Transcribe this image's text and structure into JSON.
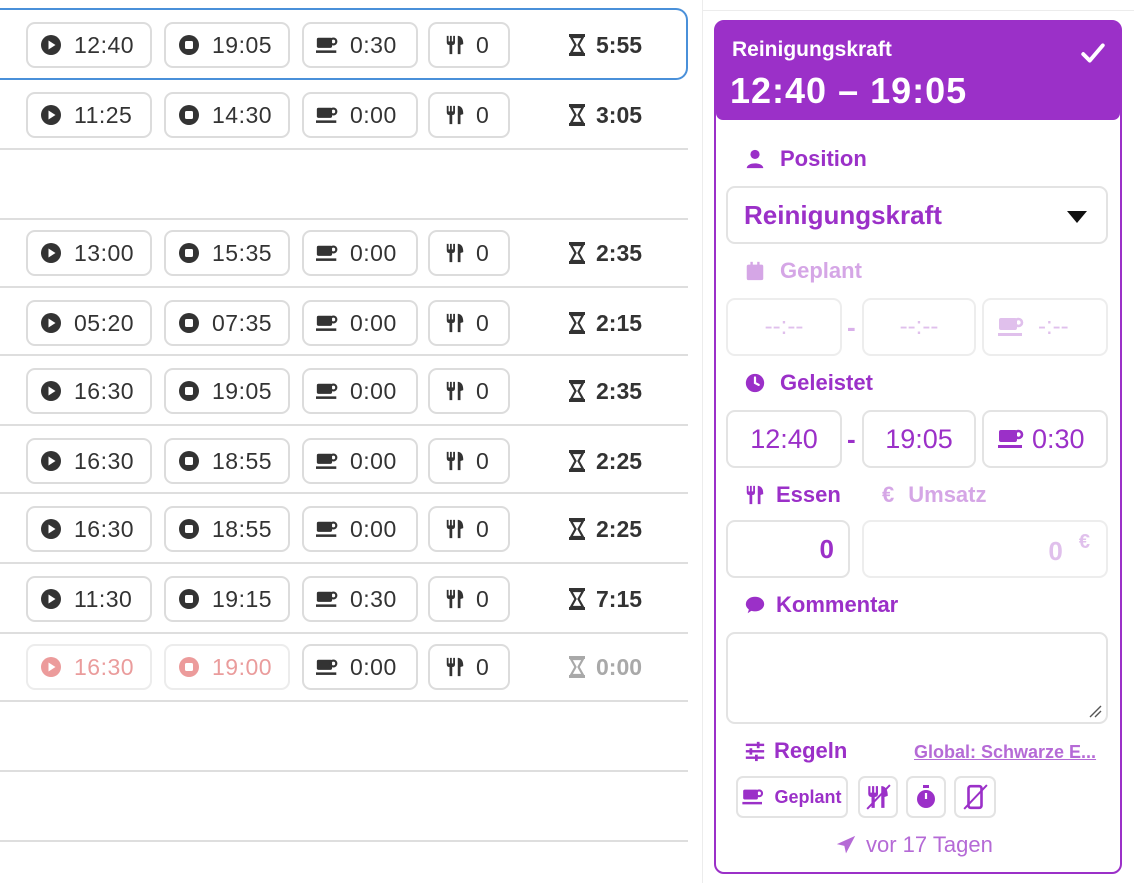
{
  "rows": [
    {
      "start": "12:40",
      "end": "19:05",
      "pause": "0:30",
      "meals": "0",
      "total": "5:55",
      "selected": true,
      "faded": false
    },
    {
      "start": "11:25",
      "end": "14:30",
      "pause": "0:00",
      "meals": "0",
      "total": "3:05",
      "selected": false,
      "faded": false
    },
    {
      "start": "13:00",
      "end": "15:35",
      "pause": "0:00",
      "meals": "0",
      "total": "2:35",
      "selected": false,
      "faded": false
    },
    {
      "start": "05:20",
      "end": "07:35",
      "pause": "0:00",
      "meals": "0",
      "total": "2:15",
      "selected": false,
      "faded": false
    },
    {
      "start": "16:30",
      "end": "19:05",
      "pause": "0:00",
      "meals": "0",
      "total": "2:35",
      "selected": false,
      "faded": false
    },
    {
      "start": "16:30",
      "end": "18:55",
      "pause": "0:00",
      "meals": "0",
      "total": "2:25",
      "selected": false,
      "faded": false
    },
    {
      "start": "16:30",
      "end": "18:55",
      "pause": "0:00",
      "meals": "0",
      "total": "2:25",
      "selected": false,
      "faded": false
    },
    {
      "start": "11:30",
      "end": "19:15",
      "pause": "0:30",
      "meals": "0",
      "total": "7:15",
      "selected": false,
      "faded": false
    },
    {
      "start": "16:30",
      "end": "19:00",
      "pause": "0:00",
      "meals": "0",
      "total": "0:00",
      "selected": false,
      "faded": true
    }
  ],
  "panel": {
    "role": "Reinigungskraft",
    "time_range": "12:40 – 19:05",
    "position_label": "Position",
    "position_value": "Reinigungskraft",
    "planned_label": "Geplant",
    "planned_start": "--:--",
    "planned_end": "--:--",
    "planned_pause": "-:--",
    "done_label": "Geleistet",
    "done_start": "12:40",
    "done_end": "19:05",
    "done_pause": "0:30",
    "meals_label": "Essen",
    "revenue_label": "Umsatz",
    "meals_value": "0",
    "revenue_value": "0",
    "currency": "€",
    "comment_label": "Kommentar",
    "comment_value": "",
    "rules_label": "Regeln",
    "rules_link": "Global: Schwarze E...",
    "rule_pause_label": "Geplant",
    "sent_text": "vor 17 Tagen",
    "separator": "-"
  },
  "colors": {
    "accent": "#9b30c8",
    "accent_light": "#d5a6e6",
    "selected_border": "#4a90d9",
    "faded_text": "#ea9c9c"
  }
}
